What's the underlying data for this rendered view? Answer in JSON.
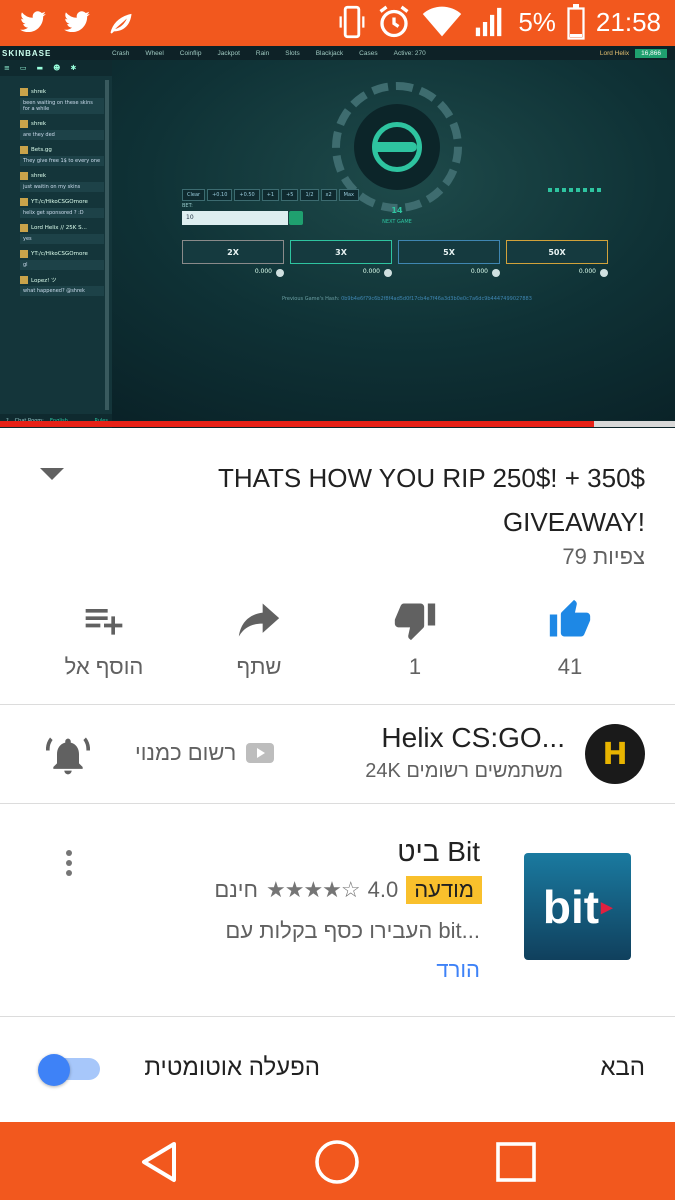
{
  "status_bar": {
    "battery": "5%",
    "time": "21:58",
    "icons": [
      "twitter-icon",
      "twitter-icon",
      "leaf-icon",
      "vibrate-icon",
      "alarm-icon",
      "wifi-icon",
      "signal-icon",
      "battery-icon"
    ]
  },
  "video": {
    "site": {
      "logo": "SKINBASE",
      "nav": [
        "Crash",
        "Wheel",
        "Coinflip",
        "Jackpot",
        "Rain",
        "Slots",
        "Blackjack",
        "Cases",
        "Active: 270"
      ],
      "user": "Lord Helix",
      "balance": "16,866"
    },
    "chat": {
      "messages": [
        {
          "user": "shrek",
          "text": "been waiting on these skins for a while"
        },
        {
          "user": "shrek",
          "text": "are they ded"
        },
        {
          "user": "Bets.gg",
          "text": "They give free 1$ to every one"
        },
        {
          "user": "shrek",
          "text": "just waitin on my skins"
        },
        {
          "user": "YT:/c/HikoCSGOmore",
          "text": "helix get sponsored ? :D"
        },
        {
          "user": "Lord Helix // 25K S...",
          "text": "yes"
        },
        {
          "user": "YT:/c/HikoCSGOmore",
          "text": "gl"
        },
        {
          "user": "Lopez! ツ",
          "text": "what happened? @shrek"
        }
      ],
      "room_label": "Chat Room:",
      "room_value": "English",
      "rules": "Rules"
    },
    "bet": {
      "buttons": [
        "Clear",
        "+0.10",
        "+0.50",
        "+1",
        "+5",
        "1/2",
        "x2",
        "Max"
      ],
      "label": "BET:",
      "value": "10",
      "multipliers": [
        {
          "label": "2X",
          "value": "0.000",
          "color": "#8a8a8a"
        },
        {
          "label": "3X",
          "value": "0.000",
          "color": "#2ec4a0"
        },
        {
          "label": "5X",
          "value": "0.000",
          "color": "#3f86b2"
        },
        {
          "label": "50X",
          "value": "0.000",
          "color": "#d1a23a"
        }
      ]
    },
    "wheel": {
      "countdown": "14",
      "label": "NEXT GAME"
    },
    "hash_label": "Previous Game's Hash:",
    "hash_value": "0b9b4e6f79c6b2f8f4ad5d0f17cb4e7f46a3d3b0e0c7a6dc9b4447499027883",
    "progress": 0.88
  },
  "video_info": {
    "title": "THATS HOW YOU RIP 250$! + 350$ GIVEAWAY!",
    "views": "79 צפיות",
    "actions": [
      {
        "name": "like",
        "label": "41",
        "icon": "thumbs-up-icon"
      },
      {
        "name": "dislike",
        "label": "1",
        "icon": "thumbs-down-icon"
      },
      {
        "name": "share",
        "label": "שתף",
        "icon": "share-icon"
      },
      {
        "name": "add-to",
        "label": "הוסף אל",
        "icon": "playlist-add-icon"
      }
    ]
  },
  "channel": {
    "name": "Helix CS:GO...",
    "subscribers": "24K משתמשים רשומים",
    "subscribe_label": "רשום כמנוי",
    "avatar_letter": "H"
  },
  "ad": {
    "title": "ביט Bit",
    "badge": "מודעה",
    "rating": "4.0",
    "stars": "★★★★☆",
    "price": "חינם",
    "description": "העבירו כסף בקלות עם bit...",
    "cta": "הורד",
    "icon_text": "bit"
  },
  "autoplay": {
    "label": "הפעלה אוטומטית",
    "next_label": "הבא",
    "enabled": true
  },
  "colors": {
    "accent": "#f2581e",
    "like_blue": "#1e88e5",
    "toggle_blue": "#3e82f7",
    "progress_red": "#e62117"
  }
}
